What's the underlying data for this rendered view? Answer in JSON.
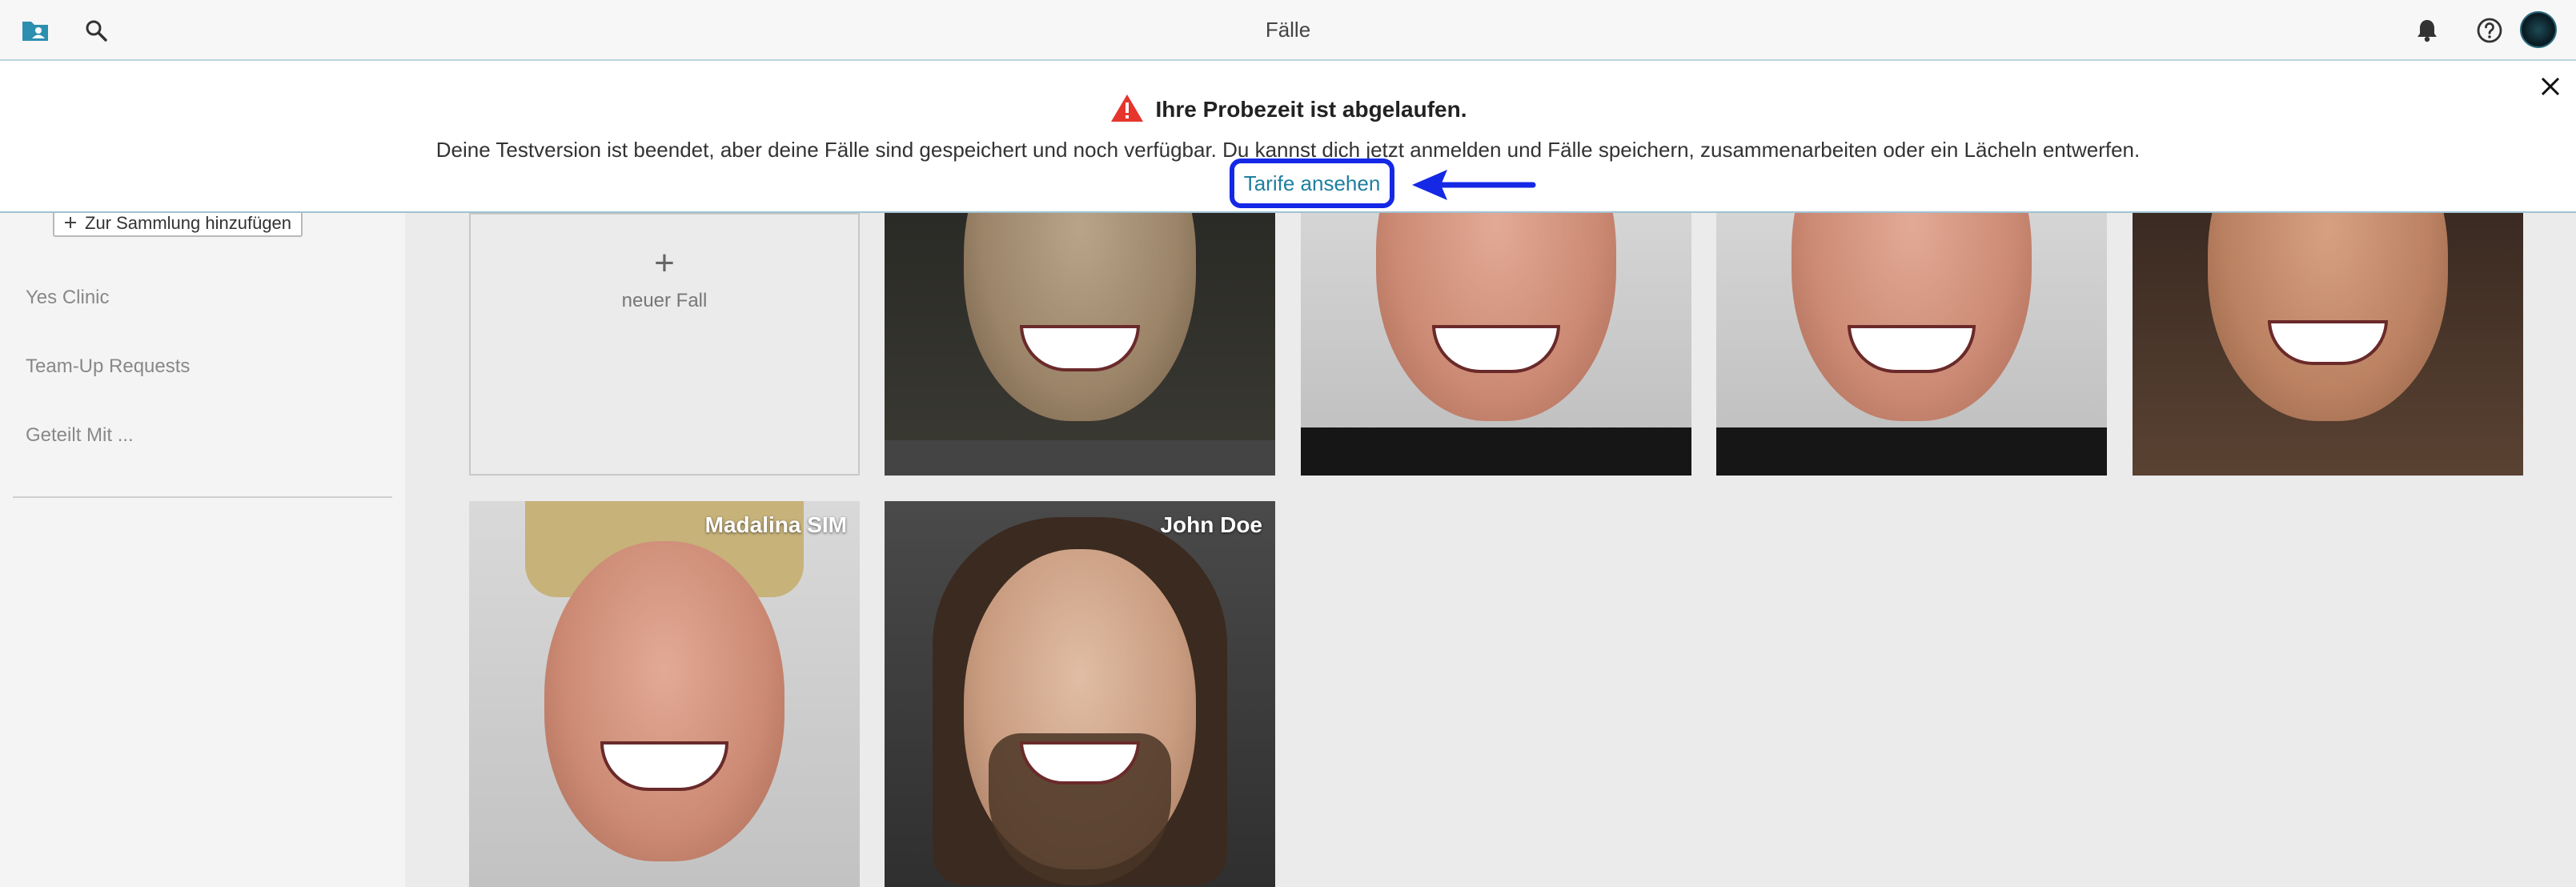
{
  "topbar": {
    "title": "Fälle",
    "icons": [
      "folder-person-icon",
      "search-icon",
      "bell-icon",
      "help-icon",
      "avatar"
    ]
  },
  "banner": {
    "headline": "Ihre Probezeit ist abgelaufen.",
    "message": "Deine Testversion ist beendet, aber deine Fälle sind gespeichert und noch verfügbar. Du kannst dich jetzt anmelden und Fälle speichern, zusammenarbeiten oder ein Lächeln entwerfen.",
    "link_label": "Tarife ansehen",
    "highlight_color": "#1428e6"
  },
  "sidebar": {
    "add_collection_label": "Zur Sammlung hinzufügen",
    "items": [
      {
        "label": "Yes Clinic"
      },
      {
        "label": "Team-Up Requests"
      },
      {
        "label": "Geteilt Mit ..."
      }
    ]
  },
  "grid": {
    "new_case_label": "neuer Fall",
    "cases": [
      {
        "name": ""
      },
      {
        "name": ""
      },
      {
        "name": ""
      },
      {
        "name": ""
      },
      {
        "name": "Madalina SIM"
      },
      {
        "name": "John Doe"
      }
    ]
  }
}
